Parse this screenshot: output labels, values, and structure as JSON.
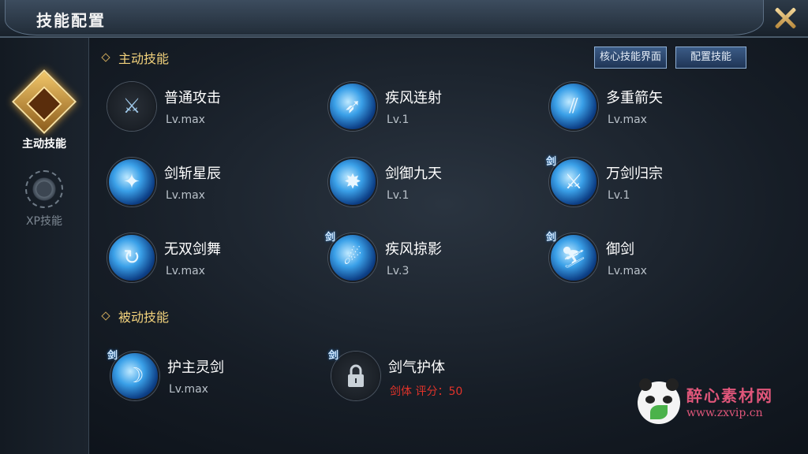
{
  "header": {
    "title": "技能配置"
  },
  "sidebar": {
    "tabs": [
      {
        "label": "主动技能",
        "active": true
      },
      {
        "label": "XP技能",
        "active": false
      }
    ]
  },
  "sections": {
    "active_title": "主动技能",
    "passive_title": "被动技能"
  },
  "buttons": {
    "core": "核心技能界面",
    "config": "配置技能"
  },
  "active_skills": [
    {
      "name": "普通攻击",
      "level": "Lv.max",
      "icon": "sword-icon",
      "tag": ""
    },
    {
      "name": "疾风连射",
      "level": "Lv.1",
      "icon": "gale-shot-icon",
      "tag": ""
    },
    {
      "name": "多重箭矢",
      "level": "Lv.max",
      "icon": "multi-arrow-icon",
      "tag": ""
    },
    {
      "name": "剑斩星辰",
      "level": "Lv.max",
      "icon": "star-slash-icon",
      "tag": ""
    },
    {
      "name": "剑御九天",
      "level": "Lv.1",
      "icon": "sky-sword-icon",
      "tag": ""
    },
    {
      "name": "万剑归宗",
      "level": "Lv.1",
      "icon": "ten-thousand-swords-icon",
      "tag": "剑"
    },
    {
      "name": "无双剑舞",
      "level": "Lv.max",
      "icon": "sword-dance-icon",
      "tag": ""
    },
    {
      "name": "疾风掠影",
      "level": "Lv.3",
      "icon": "gale-shadow-icon",
      "tag": "剑"
    },
    {
      "name": "御剑",
      "level": "Lv.max",
      "icon": "sword-ride-icon",
      "tag": "剑"
    }
  ],
  "passive_skills": [
    {
      "name": "护主灵剑",
      "level": "Lv.max",
      "icon": "guardian-sword-icon",
      "tag": "剑",
      "level_color": "#b9c1c9"
    },
    {
      "name": "剑气护体",
      "level": "剑体 评分：50",
      "icon": "lock-icon",
      "tag": "剑",
      "level_color": "#e0332a"
    }
  ],
  "watermark": {
    "cn": "醉心素材网",
    "url": "www.zxvip.cn"
  },
  "colors": {
    "accent_gold": "#f2d27c",
    "locked_red": "#e0332a",
    "button_blue": "#2b4a72"
  }
}
